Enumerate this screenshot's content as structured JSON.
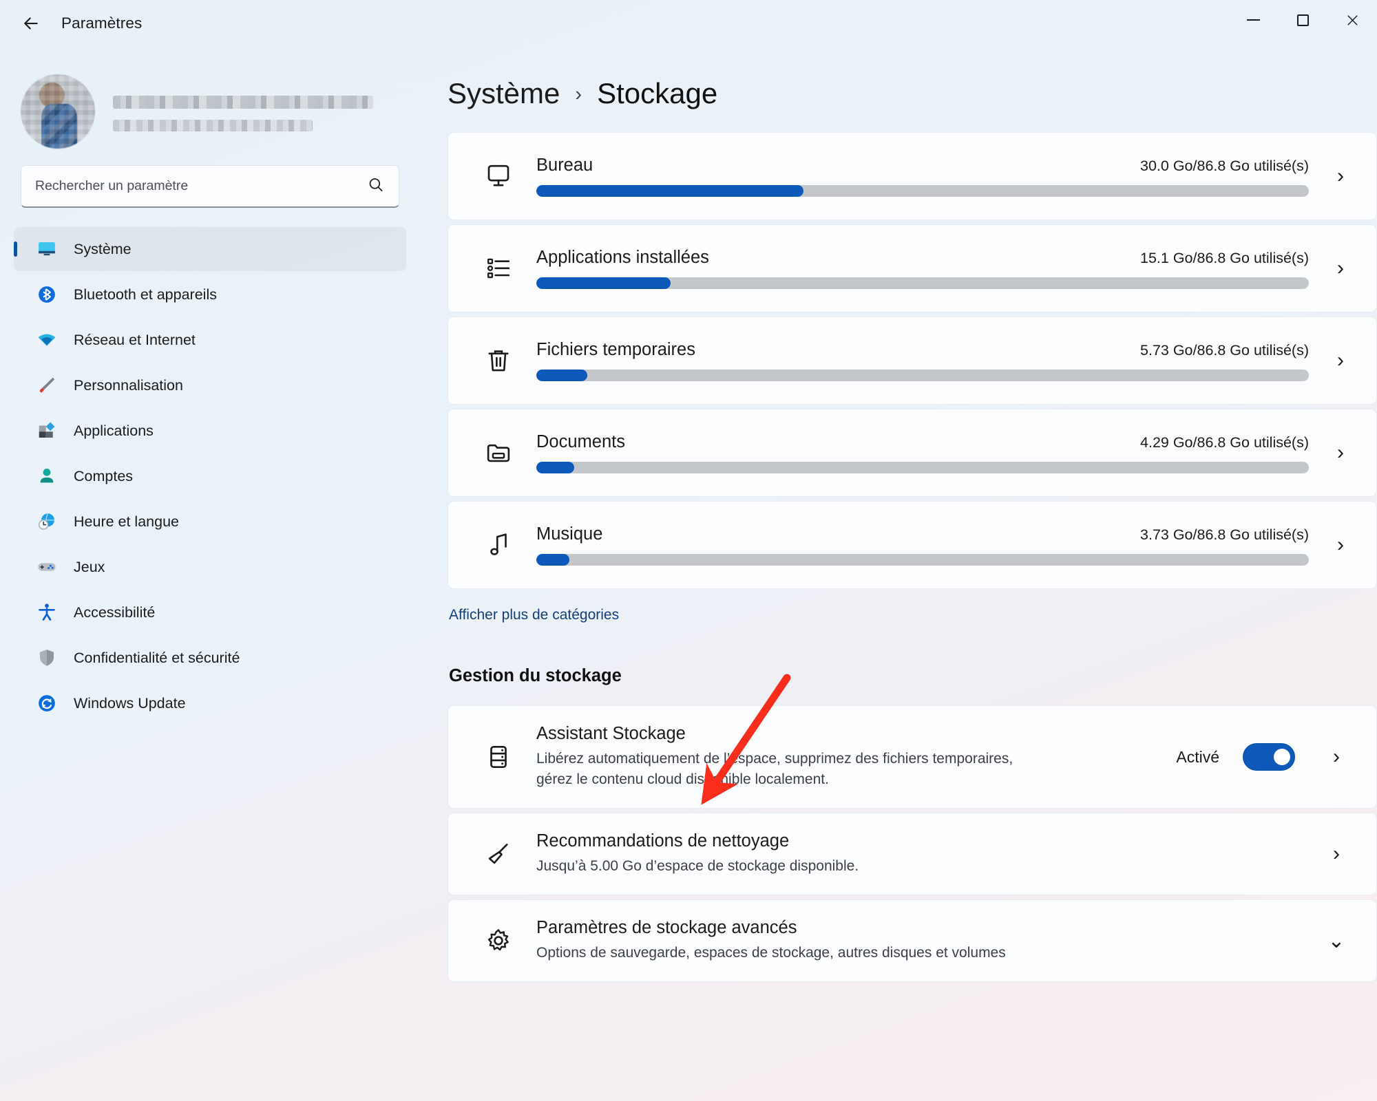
{
  "window": {
    "title": "Paramètres",
    "back_icon": "back-arrow-icon",
    "minimize_label": "—",
    "maximize_label": "□",
    "close_label": "✕"
  },
  "account": {
    "name_redacted": true,
    "email_redacted": true
  },
  "search": {
    "placeholder": "Rechercher un paramètre",
    "value": "",
    "icon": "search-icon"
  },
  "sidebar": {
    "items": [
      {
        "label": "Système",
        "icon": "monitor-icon",
        "active": true
      },
      {
        "label": "Bluetooth et appareils",
        "icon": "bluetooth-icon",
        "active": false
      },
      {
        "label": "Réseau et Internet",
        "icon": "wifi-icon",
        "active": false
      },
      {
        "label": "Personnalisation",
        "icon": "paintbrush-icon",
        "active": false
      },
      {
        "label": "Applications",
        "icon": "apps-icon",
        "active": false
      },
      {
        "label": "Comptes",
        "icon": "person-icon",
        "active": false
      },
      {
        "label": "Heure et langue",
        "icon": "globe-clock-icon",
        "active": false
      },
      {
        "label": "Jeux",
        "icon": "gamepad-icon",
        "active": false
      },
      {
        "label": "Accessibilité",
        "icon": "accessibility-icon",
        "active": false
      },
      {
        "label": "Confidentialité et sécurité",
        "icon": "shield-icon",
        "active": false
      },
      {
        "label": "Windows Update",
        "icon": "update-icon",
        "active": false
      }
    ]
  },
  "breadcrumb": {
    "parent": "Système",
    "separator": "›",
    "current": "Stockage"
  },
  "storage": {
    "total": "86.8 Go",
    "categories": [
      {
        "name": "Bureau",
        "icon": "monitor-icon",
        "used": "30.0 Go",
        "size_text": "30.0 Go/86.8 Go utilisé(s)",
        "percent": 34.6,
        "chevron": "›"
      },
      {
        "name": "Applications installées",
        "icon": "list-icon",
        "used": "15.1 Go",
        "size_text": "15.1 Go/86.8 Go utilisé(s)",
        "percent": 17.4,
        "chevron": "›"
      },
      {
        "name": "Fichiers temporaires",
        "icon": "trash-icon",
        "used": "5.73 Go",
        "size_text": "5.73 Go/86.8 Go utilisé(s)",
        "percent": 6.6,
        "chevron": "›"
      },
      {
        "name": "Documents",
        "icon": "folder-icon",
        "used": "4.29 Go",
        "size_text": "4.29 Go/86.8 Go utilisé(s)",
        "percent": 4.9,
        "chevron": "›"
      },
      {
        "name": "Musique",
        "icon": "music-note-icon",
        "used": "3.73 Go",
        "size_text": "3.73 Go/86.8 Go utilisé(s)",
        "percent": 4.3,
        "chevron": "›"
      }
    ],
    "show_more_label": "Afficher plus de catégories"
  },
  "management": {
    "section_title": "Gestion du stockage",
    "items": [
      {
        "title": "Assistant Stockage",
        "subtitle": "Libérez automatiquement de l’espace, supprimez des fichiers temporaires, gérez le contenu cloud disponible localement.",
        "icon": "drive-icon",
        "toggle_label": "Activé",
        "toggle_on": true,
        "chevron": "›"
      },
      {
        "title": "Recommandations de nettoyage",
        "subtitle": "Jusqu’à 5.00 Go d’espace de stockage disponible.",
        "icon": "broom-icon",
        "chevron": "›"
      },
      {
        "title": "Paramètres de stockage avancés",
        "subtitle": "Options de sauvegarde, espaces de stockage, autres disques et volumes",
        "icon": "gear-icon",
        "chevron": "⌄"
      }
    ]
  },
  "annotation": {
    "type": "arrow",
    "color": "#f92d1c",
    "points_to": "Assistant Stockage"
  },
  "colors": {
    "accent": "#0c59ba",
    "link": "#123f78",
    "bar_track": "#c4c7ca",
    "card_bg": "#fbfdfe",
    "annotation_red": "#f92d1c"
  }
}
